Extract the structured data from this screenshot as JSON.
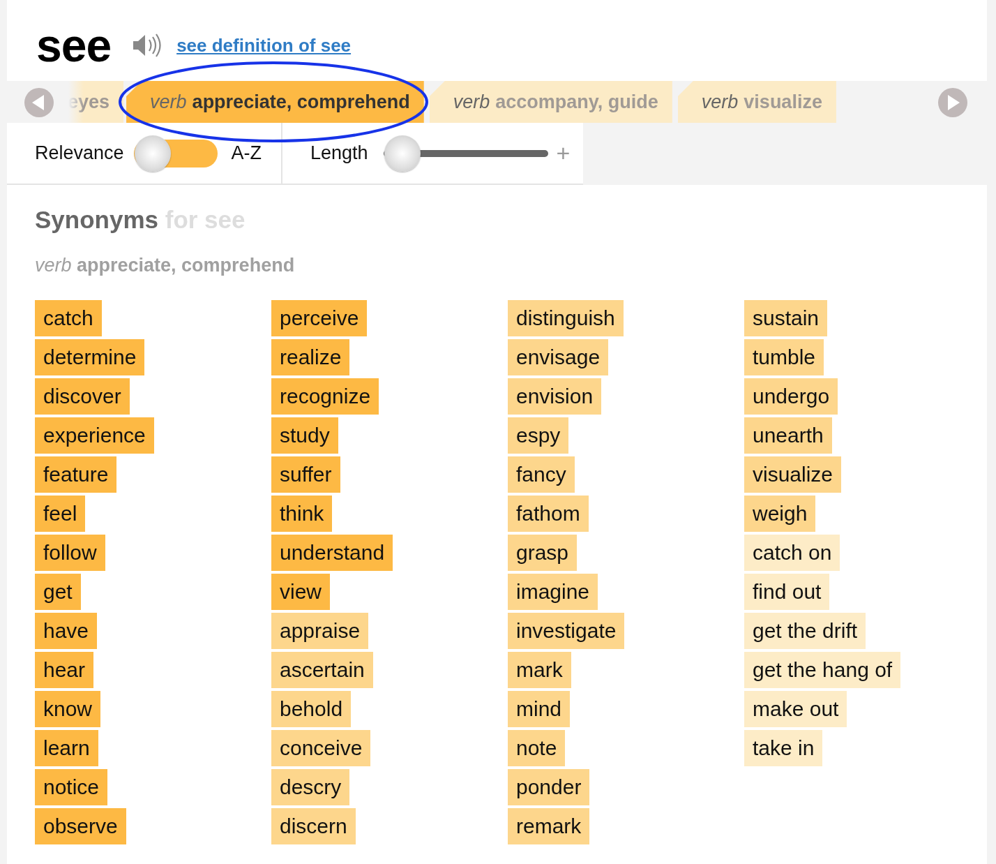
{
  "header": {
    "word": "see",
    "definition_link": "see definition of see"
  },
  "tabs": [
    {
      "label": "eyes",
      "selected": false
    },
    {
      "pos": "verb",
      "label": "appreciate, comprehend",
      "selected": true
    },
    {
      "pos": "verb",
      "label": "accompany, guide",
      "selected": false
    },
    {
      "pos": "verb",
      "label": "visualize",
      "selected": false
    }
  ],
  "filters": {
    "sort_left": "Relevance",
    "sort_right": "A-Z",
    "sort_on": false,
    "length_label": "Length",
    "length": {
      "level": 0
    },
    "length_plus": "+"
  },
  "heading": {
    "title": "Synonyms",
    "subtitle": "for see"
  },
  "sense": {
    "pos": "verb",
    "label": "appreciate, comprehend"
  },
  "synonyms": [
    {
      "word": "catch",
      "color": "#fdb944"
    },
    {
      "word": "determine",
      "color": "#fdb944"
    },
    {
      "word": "discover",
      "color": "#fdb944"
    },
    {
      "word": "experience",
      "color": "#fdb944"
    },
    {
      "word": "feature",
      "color": "#fdb944"
    },
    {
      "word": "feel",
      "color": "#fdb944"
    },
    {
      "word": "follow",
      "color": "#fdb944"
    },
    {
      "word": "get",
      "color": "#fdb944"
    },
    {
      "word": "have",
      "color": "#fdb944"
    },
    {
      "word": "hear",
      "color": "#fdb944"
    },
    {
      "word": "know",
      "color": "#fdb944"
    },
    {
      "word": "learn",
      "color": "#fdb944"
    },
    {
      "word": "notice",
      "color": "#fdb944"
    },
    {
      "word": "observe",
      "color": "#fdb944"
    },
    {
      "word": "perceive",
      "color": "#fdb944"
    },
    {
      "word": "realize",
      "color": "#fdb944"
    },
    {
      "word": "recognize",
      "color": "#fdb944"
    },
    {
      "word": "study",
      "color": "#fdb944"
    },
    {
      "word": "suffer",
      "color": "#fdb944"
    },
    {
      "word": "think",
      "color": "#fdb944"
    },
    {
      "word": "understand",
      "color": "#fdb944"
    },
    {
      "word": "view",
      "color": "#fdb944"
    },
    {
      "word": "appraise",
      "color": "#fdd68c"
    },
    {
      "word": "ascertain",
      "color": "#fdd68c"
    },
    {
      "word": "behold",
      "color": "#fdd68c"
    },
    {
      "word": "conceive",
      "color": "#fdd68c"
    },
    {
      "word": "descry",
      "color": "#fdd68c"
    },
    {
      "word": "discern",
      "color": "#fdd68c"
    },
    {
      "word": "distinguish",
      "color": "#fdd68c"
    },
    {
      "word": "envisage",
      "color": "#fdd68c"
    },
    {
      "word": "envision",
      "color": "#fdd68c"
    },
    {
      "word": "espy",
      "color": "#fdd68c"
    },
    {
      "word": "fancy",
      "color": "#fdd68c"
    },
    {
      "word": "fathom",
      "color": "#fdd68c"
    },
    {
      "word": "grasp",
      "color": "#fdd68c"
    },
    {
      "word": "imagine",
      "color": "#fdd68c"
    },
    {
      "word": "investigate",
      "color": "#fdd68c"
    },
    {
      "word": "mark",
      "color": "#fdd68c"
    },
    {
      "word": "mind",
      "color": "#fdd68c"
    },
    {
      "word": "note",
      "color": "#fdd68c"
    },
    {
      "word": "ponder",
      "color": "#fdd68c"
    },
    {
      "word": "remark",
      "color": "#fdd68c"
    },
    {
      "word": "sustain",
      "color": "#fdd68c"
    },
    {
      "word": "tumble",
      "color": "#fdd68c"
    },
    {
      "word": "undergo",
      "color": "#fdd68c"
    },
    {
      "word": "unearth",
      "color": "#fdd68c"
    },
    {
      "word": "visualize",
      "color": "#fdd68c"
    },
    {
      "word": "weigh",
      "color": "#fdd68c"
    },
    {
      "word": "catch on",
      "color": "#fdecc7"
    },
    {
      "word": "find out",
      "color": "#fdecc7"
    },
    {
      "word": "get the drift",
      "color": "#fdecc7"
    },
    {
      "word": "get the hang of",
      "color": "#fdecc7"
    },
    {
      "word": "make out",
      "color": "#fdecc7"
    },
    {
      "word": "take in",
      "color": "#fdecc7"
    }
  ]
}
